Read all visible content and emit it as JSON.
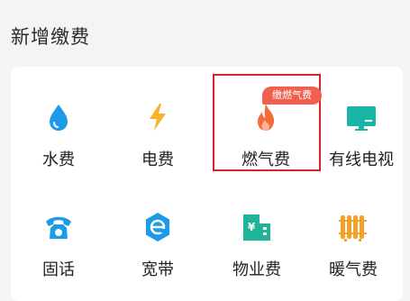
{
  "section": {
    "title": "新增缴费"
  },
  "items": [
    {
      "label": "水费",
      "icon": "water-drop-icon",
      "color": "#1e9be8"
    },
    {
      "label": "电费",
      "icon": "lightning-icon",
      "color": "#f7b32b"
    },
    {
      "label": "燃气费",
      "icon": "flame-icon",
      "color": "#f26b3a",
      "badge": "缴燃气费"
    },
    {
      "label": "有线电视",
      "icon": "tv-icon",
      "color": "#1ab5a6"
    },
    {
      "label": "固话",
      "icon": "telephone-icon",
      "color": "#1e9be8"
    },
    {
      "label": "宽带",
      "icon": "broadband-icon",
      "color": "#1e9be8"
    },
    {
      "label": "物业费",
      "icon": "building-icon",
      "color": "#22b49a"
    },
    {
      "label": "暖气费",
      "icon": "radiator-icon",
      "color": "#f2a12a"
    }
  ]
}
